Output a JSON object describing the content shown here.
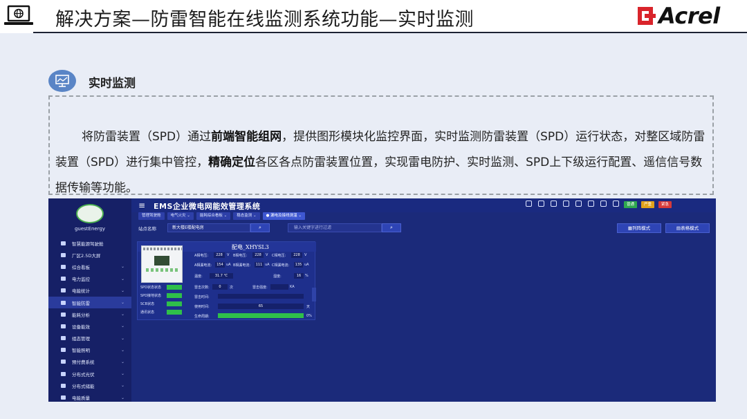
{
  "slide": {
    "title": "解决方案—防雷智能在线监测系统功能—实时监测",
    "logo_text": "Acrel"
  },
  "section": {
    "title": "实时监测",
    "desc_parts": {
      "p1": "将防雷装置（SPD）通过",
      "b1": "前端智能组网",
      "p2": "，提供图形模块化监控界面，实时监测防雷装置（SPD）运行状态，对整区域防雷装置（SPD）进行集中管控，",
      "b2": "精确定位",
      "p3": "各区各点防雷装置位置，实现雷电防护、实时监测、SPD上下级运行配置、遥信信号数据传输等功能。"
    }
  },
  "app": {
    "title": "EMS企业微电网能效管理系统",
    "menu_icon": "≡",
    "username": "guestEnergy",
    "badges": [
      {
        "label": "普通",
        "color": "#2fa84f"
      },
      {
        "label": "严重",
        "color": "#e0a21b"
      },
      {
        "label": "紧急",
        "color": "#d63a3a"
      }
    ],
    "top_icons": [
      "search-icon",
      "globe-icon",
      "volume-icon",
      "refresh-icon",
      "fullscreen-icon",
      "image-icon",
      "shirt-icon",
      "user-icon"
    ],
    "tabs": [
      {
        "label": "管理驾驶舱",
        "active": false
      },
      {
        "label": "电气火灾 ⌄",
        "active": false
      },
      {
        "label": "能耗综合看板 ⌄",
        "active": false
      },
      {
        "label": "稳态监测 ⌄",
        "active": false
      },
      {
        "label": "● 漏电及接线测温 ⌄",
        "active": true
      }
    ],
    "menu": [
      {
        "label": "智慧能源驾驶舱",
        "arrow": ""
      },
      {
        "label": "厂区2.5D大屏",
        "arrow": ""
      },
      {
        "label": "综合看板",
        "arrow": "⌄"
      },
      {
        "label": "电力监控",
        "arrow": "⌄"
      },
      {
        "label": "电能统计",
        "arrow": "⌄"
      },
      {
        "label": "智能防雷",
        "arrow": "⌄"
      },
      {
        "label": "能耗分析",
        "arrow": "⌄"
      },
      {
        "label": "设备能效",
        "arrow": "⌄"
      },
      {
        "label": "组态管理",
        "arrow": "⌄"
      },
      {
        "label": "智能照明",
        "arrow": "⌄"
      },
      {
        "label": "预付费系统",
        "arrow": "⌄"
      },
      {
        "label": "分布式光伏",
        "arrow": "⌄"
      },
      {
        "label": "分布式储能",
        "arrow": "⌄"
      },
      {
        "label": "电能质量",
        "arrow": "⌄"
      }
    ],
    "filter": {
      "station_label": "站点名称",
      "station_value": "新大楼E楼配电房",
      "search_symbol": "⌕",
      "keyword_placeholder": "输入关键字进行过滤",
      "list_mode": "▦列阵模式",
      "table_mode": "▤表格模式"
    },
    "card": {
      "title": "配电_XHYSL3",
      "a_voltage_label": "A相电压:",
      "a_voltage": "228",
      "b_voltage_label": "B相电压:",
      "b_voltage": "228",
      "c_voltage_label": "C相电压:",
      "c_voltage": "228",
      "v_unit": "V",
      "a_leak_label": "A相漏电流:",
      "a_leak": "154",
      "b_leak_label": "B相漏电流:",
      "b_leak": "111",
      "c_leak_label": "C相漏电流:",
      "c_leak": "135",
      "ua_unit": "uA",
      "temp_label": "温度:",
      "temp": "31.7 ℃",
      "humidity_label": "湿度:",
      "humidity": "16",
      "humidity_unit": "%",
      "strike_count_label": "雷击次数:",
      "strike_count": "0",
      "strike_count_unit": "次",
      "strike_strength_label": "雷击强度:",
      "strike_strength_unit": "KA",
      "strike_time_label": "雷击时间:",
      "usage_label": "使用时间:",
      "usage": "65",
      "usage_unit": "天",
      "life_label": "生命周期:",
      "life_unit": "0%",
      "statuses": [
        "SPD状态状态",
        "SPD接地状态",
        "SCB状态",
        "通讯状态"
      ]
    }
  }
}
